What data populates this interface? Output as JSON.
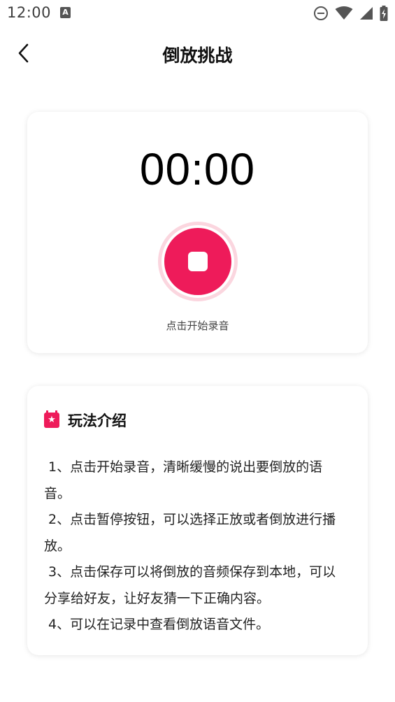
{
  "status_bar": {
    "time": "12:00",
    "notification_icon_letter": "A",
    "icons": [
      "a-notification-icon",
      "do-not-disturb-icon",
      "wifi-icon",
      "signal-icon",
      "battery-charging-icon"
    ]
  },
  "header": {
    "title": "倒放挑战",
    "back_icon": "chevron-left-icon"
  },
  "recorder": {
    "timer": "00:00",
    "hint": "点击开始录音",
    "accent_color": "#ee1b5a"
  },
  "intro": {
    "title": "玩法介绍",
    "lines": [
      " 1、点击开始录音，清晰缓慢的说出要倒放的语音。",
      " 2、点击暂停按钮，可以选择正放或者倒放进行播放。",
      " 3、点击保存可以将倒放的音频保存到本地，可以分享给好友，让好友猜一下正确内容。",
      " 4、可以在记录中查看倒放语音文件。"
    ]
  }
}
